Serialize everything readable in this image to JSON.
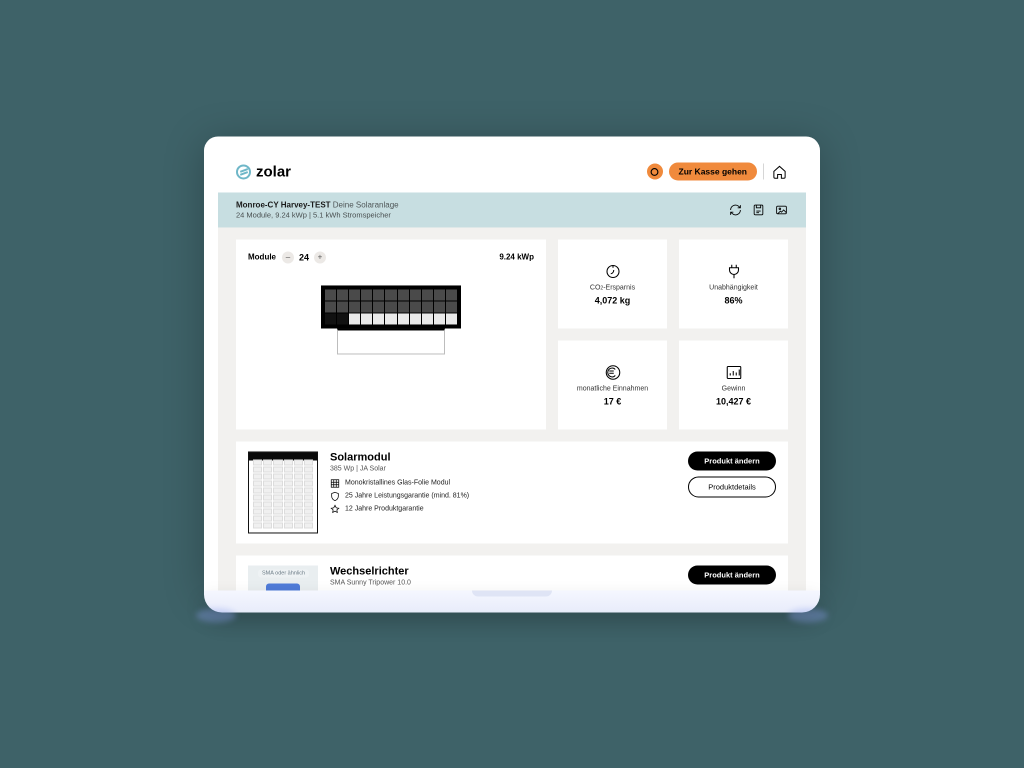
{
  "header": {
    "brand": "zolar",
    "cta": "Zur Kasse gehen"
  },
  "banner": {
    "title": "Monroe-CY Harvey-TEST",
    "title_suffix": "Deine Solaranlage",
    "meta": "24 Module, 9.24 kWp | 5.1 kWh Stromspeicher"
  },
  "module_card": {
    "label": "Module",
    "count": "24",
    "power": "9.24 kWp"
  },
  "stats": {
    "co2": {
      "label_prefix": "CO",
      "label_suffix": "-Ersparnis",
      "value": "4,072 kg"
    },
    "independence": {
      "label": "Unabhängigkeit",
      "value": "86%"
    },
    "monthly": {
      "label": "monatliche Einnahmen",
      "value": "17 €"
    },
    "profit": {
      "label": "Gewinn",
      "value": "10,427 €"
    }
  },
  "product_solar": {
    "title": "Solarmodul",
    "subtitle": "385 Wp | JA Solar",
    "features": [
      "Monokristallines Glas-Folie Modul",
      "25 Jahre Leistungsgarantie (mind. 81%)",
      "12 Jahre Produktgarantie"
    ],
    "btn_change": "Produkt ändern",
    "btn_details": "Produktdetails"
  },
  "product_inverter": {
    "title": "Wechselrichter",
    "subtitle": "SMA Sunny Tripower 10.0",
    "image_tag": "SMA oder ähnlich",
    "btn_change": "Produkt ändern"
  }
}
